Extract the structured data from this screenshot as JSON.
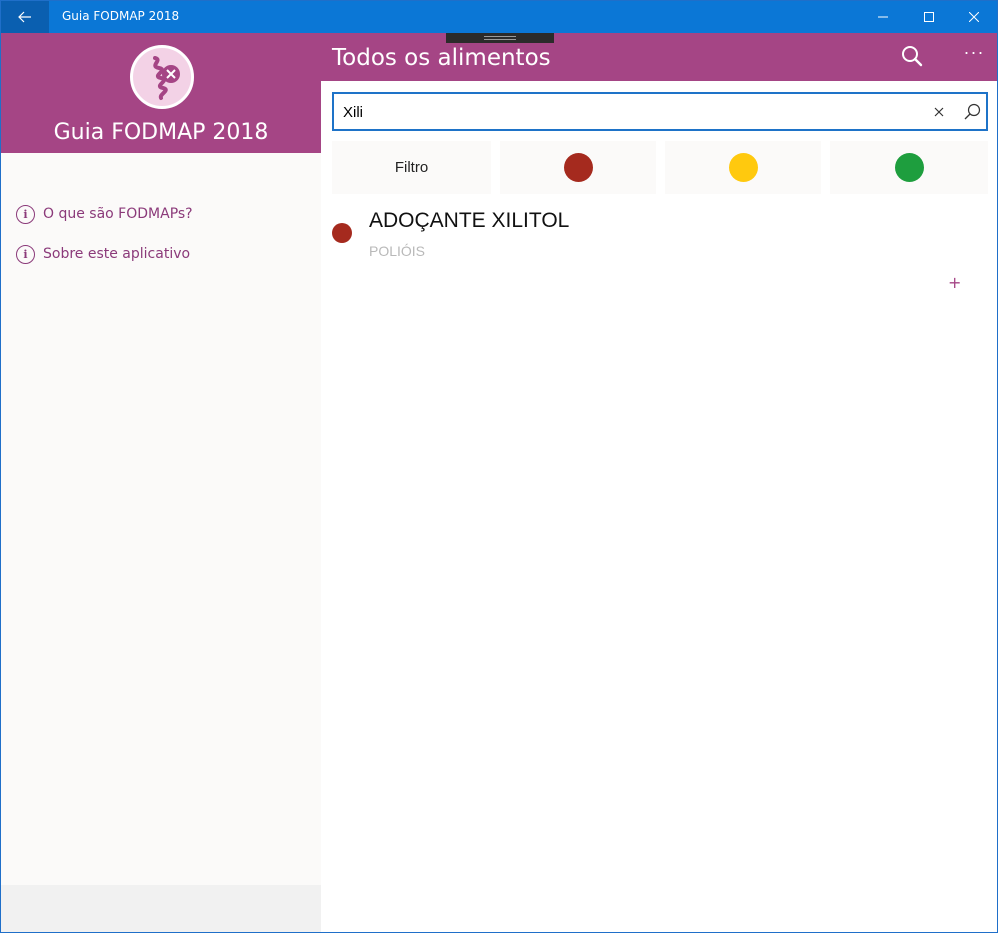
{
  "window": {
    "title": "Guia FODMAP 2018",
    "back_icon": "arrow-left-icon",
    "minimize_icon": "minimize-icon",
    "maximize_icon": "maximize-icon",
    "close_icon": "close-icon"
  },
  "sidebar": {
    "app_title": "Guia FODMAP 2018",
    "logo_icon": "intestine-logo-icon",
    "items": [
      {
        "label": "O que são FODMAPs?",
        "icon": "info-icon"
      },
      {
        "label": "Sobre este aplicativo",
        "icon": "info-icon"
      }
    ]
  },
  "main": {
    "title": "Todos os alimentos",
    "search_icon": "search-icon",
    "more_icon": "more-icon",
    "more_label": "···",
    "search": {
      "value": "Xili",
      "placeholder": "",
      "clear_icon": "clear-icon",
      "submit_icon": "search-icon"
    },
    "filter": {
      "label": "Filtro",
      "options": [
        {
          "name": "red",
          "color": "#a52a1e"
        },
        {
          "name": "yellow",
          "color": "#ffc90e"
        },
        {
          "name": "green",
          "color": "#1e9e3e"
        }
      ]
    },
    "results": [
      {
        "name": "ADOÇANTE XILITOL",
        "category": "POLIÓIS",
        "status_color": "#a52a1e",
        "add_label": "+"
      }
    ]
  },
  "colors": {
    "brand": "#a54585",
    "titlebar": "#0b77d6",
    "focus": "#1e73c8"
  }
}
